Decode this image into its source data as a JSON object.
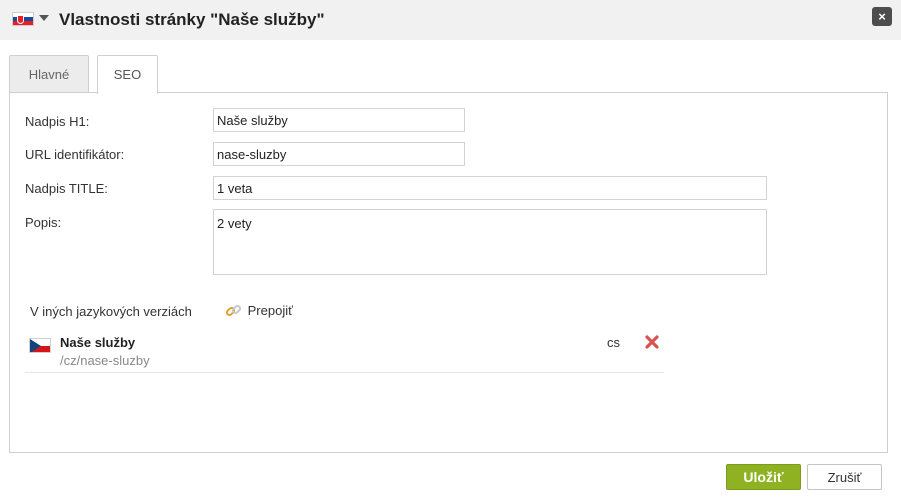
{
  "window": {
    "title": "Vlastnosti stránky \"Naše služby\"",
    "flag_icon": "slovakia-flag-icon",
    "menu_icon": "caret-down-icon",
    "close_label": "×"
  },
  "tabs": [
    {
      "label": "Hlavné",
      "active": false
    },
    {
      "label": "SEO",
      "active": true
    }
  ],
  "form": {
    "h1": {
      "label": "Nadpis H1:",
      "value": "Naše služby"
    },
    "url": {
      "label": "URL identifikátor:",
      "value": "nase-sluzby"
    },
    "title": {
      "label": "Nadpis TITLE:",
      "value": "1 veta"
    },
    "description": {
      "label": "Popis:",
      "value": "2 vety"
    }
  },
  "language_versions": {
    "label": "V iných jazykových verziách",
    "relink_label": "Prepojiť",
    "relink_icon": "chain-link-icon",
    "items": [
      {
        "flag_icon": "czech-flag-icon",
        "name": "Naše služby",
        "url": "/cz/nase-sluzby",
        "lang": "cs",
        "remove_icon": "remove-x-icon"
      }
    ]
  },
  "actions": {
    "save_label": "Uložiť",
    "cancel_label": "Zrušiť"
  },
  "colors": {
    "accent_green": "#8fb223",
    "remove_red": "#d9534f",
    "titlebar_bg": "#f1f1f1"
  }
}
